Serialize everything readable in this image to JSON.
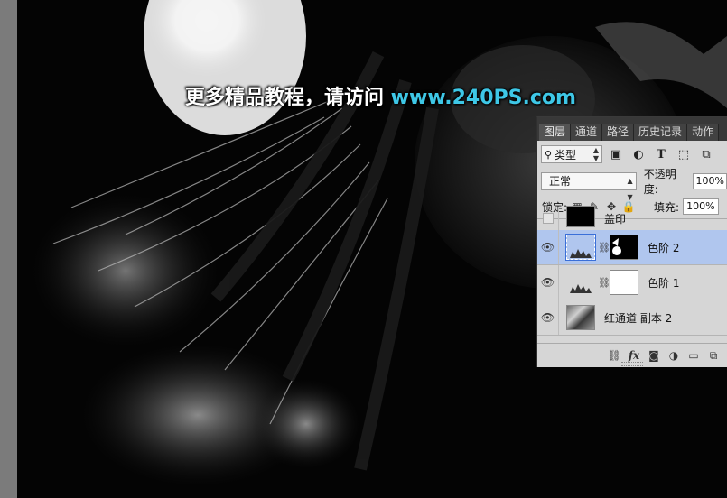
{
  "watermark": {
    "text": "更多精品教程，请访问 ",
    "url": "www.240PS.com"
  },
  "panel": {
    "tabs": [
      {
        "label": "图层",
        "active": true
      },
      {
        "label": "通道",
        "active": false
      },
      {
        "label": "路径",
        "active": false
      },
      {
        "label": "历史记录",
        "active": false
      },
      {
        "label": "动作",
        "active": false
      }
    ],
    "filter": {
      "value": "类型"
    },
    "filter_icons": [
      "image-filter-icon",
      "adjustment-filter-icon",
      "type-filter-icon",
      "shape-filter-icon",
      "smart-object-filter-icon"
    ],
    "blend_mode": "正常",
    "opacity_label": "不透明度:",
    "opacity_value": "100%",
    "lock_label": "锁定:",
    "fill_label": "填充:",
    "fill_value": "100%",
    "layers": [
      {
        "name": "盖印",
        "visible": false,
        "selected": false
      },
      {
        "name": "色阶 2",
        "visible": true,
        "selected": true
      },
      {
        "name": "色阶 1",
        "visible": true,
        "selected": false
      },
      {
        "name": "红通道 副本 2",
        "visible": true,
        "selected": false
      }
    ],
    "bottom_icons": [
      "link-layers-icon",
      "fx-icon",
      "add-mask-icon",
      "new-adjustment-icon",
      "new-group-icon",
      "new-layer-icon"
    ]
  },
  "colors": {
    "selected_row": "#b0c6ee",
    "watermark_url": "#3ec7e6",
    "panel_bg": "#d6d6d6"
  }
}
